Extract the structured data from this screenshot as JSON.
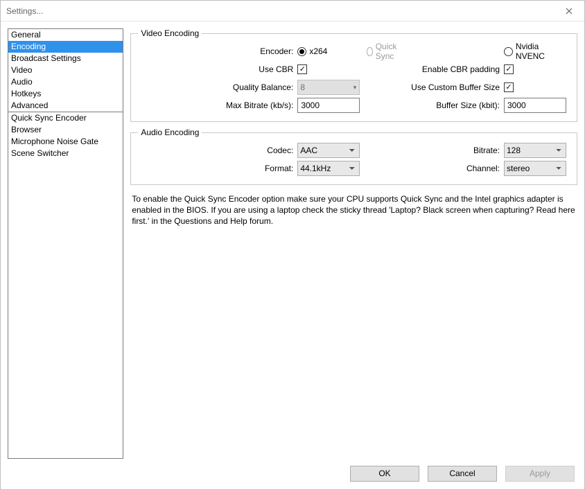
{
  "window": {
    "title": "Settings..."
  },
  "sidebar": {
    "items": [
      {
        "label": "General"
      },
      {
        "label": "Encoding",
        "selected": true
      },
      {
        "label": "Broadcast Settings"
      },
      {
        "label": "Video"
      },
      {
        "label": "Audio"
      },
      {
        "label": "Hotkeys"
      },
      {
        "label": "Advanced"
      },
      {
        "label": "Quick Sync Encoder",
        "divider": true
      },
      {
        "label": "Browser"
      },
      {
        "label": "Microphone Noise Gate"
      },
      {
        "label": "Scene Switcher"
      }
    ]
  },
  "video": {
    "legend": "Video Encoding",
    "encoder_label": "Encoder:",
    "encoders": {
      "x264": "x264",
      "quicksync": "Quick Sync",
      "nvenc": "Nvidia NVENC",
      "selected": "x264",
      "quicksync_disabled": true
    },
    "use_cbr_label": "Use CBR",
    "use_cbr": true,
    "enable_cbr_padding_label": "Enable CBR padding",
    "enable_cbr_padding": true,
    "quality_label": "Quality Balance:",
    "quality_value": "8",
    "custom_buffer_label": "Use Custom Buffer Size",
    "custom_buffer": true,
    "max_bitrate_label": "Max Bitrate (kb/s):",
    "max_bitrate": "3000",
    "buffer_size_label": "Buffer Size (kbit):",
    "buffer_size": "3000"
  },
  "audio": {
    "legend": "Audio Encoding",
    "codec_label": "Codec:",
    "codec": "AAC",
    "format_label": "Format:",
    "format": "44.1kHz",
    "bitrate_label": "Bitrate:",
    "bitrate": "128",
    "channel_label": "Channel:",
    "channel": "stereo"
  },
  "help_text": "To enable the Quick Sync Encoder option make sure your CPU supports Quick Sync and the Intel graphics adapter is enabled in the BIOS. If you are using a laptop check the sticky thread 'Laptop? Black screen when capturing? Read here first.' in the Questions and Help forum.",
  "buttons": {
    "ok": "OK",
    "cancel": "Cancel",
    "apply": "Apply"
  }
}
